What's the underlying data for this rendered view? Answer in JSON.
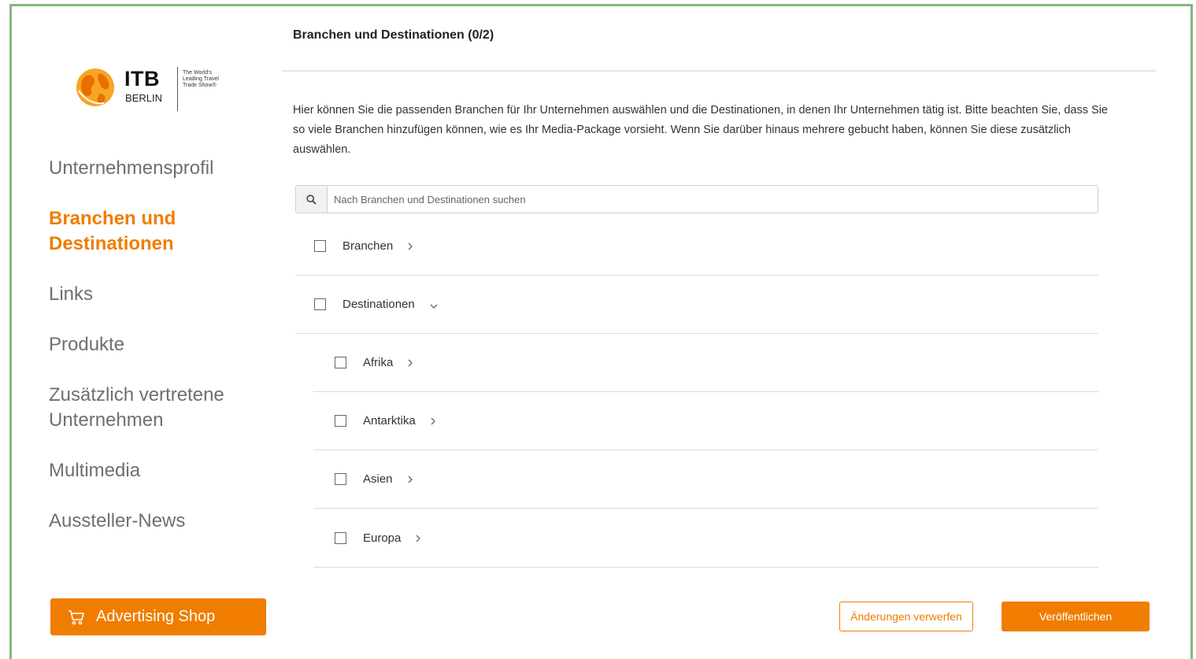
{
  "brand": {
    "logo_text": "ITB",
    "logo_subtext": "BERLIN",
    "tagline": "The World's Leading Travel Trade Show®",
    "accent_color": "#f07d00",
    "frame_color": "#86b77c"
  },
  "sidebar": {
    "items": [
      {
        "label": "Unternehmensprofil",
        "active": false
      },
      {
        "label": "Branchen und Destinationen",
        "active": true
      },
      {
        "label": "Links",
        "active": false
      },
      {
        "label": "Produkte",
        "active": false
      },
      {
        "label": "Zusätzlich vertretene Unternehmen",
        "active": false
      },
      {
        "label": "Multimedia",
        "active": false
      },
      {
        "label": "Aussteller-News",
        "active": false
      }
    ],
    "shop_button": {
      "label": "Advertising Shop",
      "icon": "cart-icon"
    }
  },
  "main": {
    "title": "Branchen und Destinationen (0/2)",
    "intro": "Hier können Sie die passenden Branchen für Ihr Unternehmen auswählen und die Destinationen, in denen Ihr Unternehmen tätig ist. Bitte beachten Sie, dass Sie so viele Branchen hinzufügen können, wie es Ihr Media-Package vorsieht. Wenn Sie darüber hinaus mehrere gebucht haben, können Sie diese zusätzlich auswählen.",
    "search": {
      "placeholder": "Nach Branchen und Destinationen suchen",
      "value": "",
      "icon": "search-icon"
    },
    "tree": [
      {
        "label": "Branchen",
        "expanded": false,
        "checked": false
      },
      {
        "label": "Destinationen",
        "expanded": true,
        "checked": false
      },
      {
        "label": "Afrika",
        "expanded": false,
        "checked": false
      },
      {
        "label": "Antarktika",
        "expanded": false,
        "checked": false
      },
      {
        "label": "Asien",
        "expanded": false,
        "checked": false
      },
      {
        "label": "Europa",
        "expanded": false,
        "checked": false
      }
    ]
  },
  "actions": {
    "discard_label": "Änderungen verwerfen",
    "publish_label": "Veröffentlichen"
  }
}
